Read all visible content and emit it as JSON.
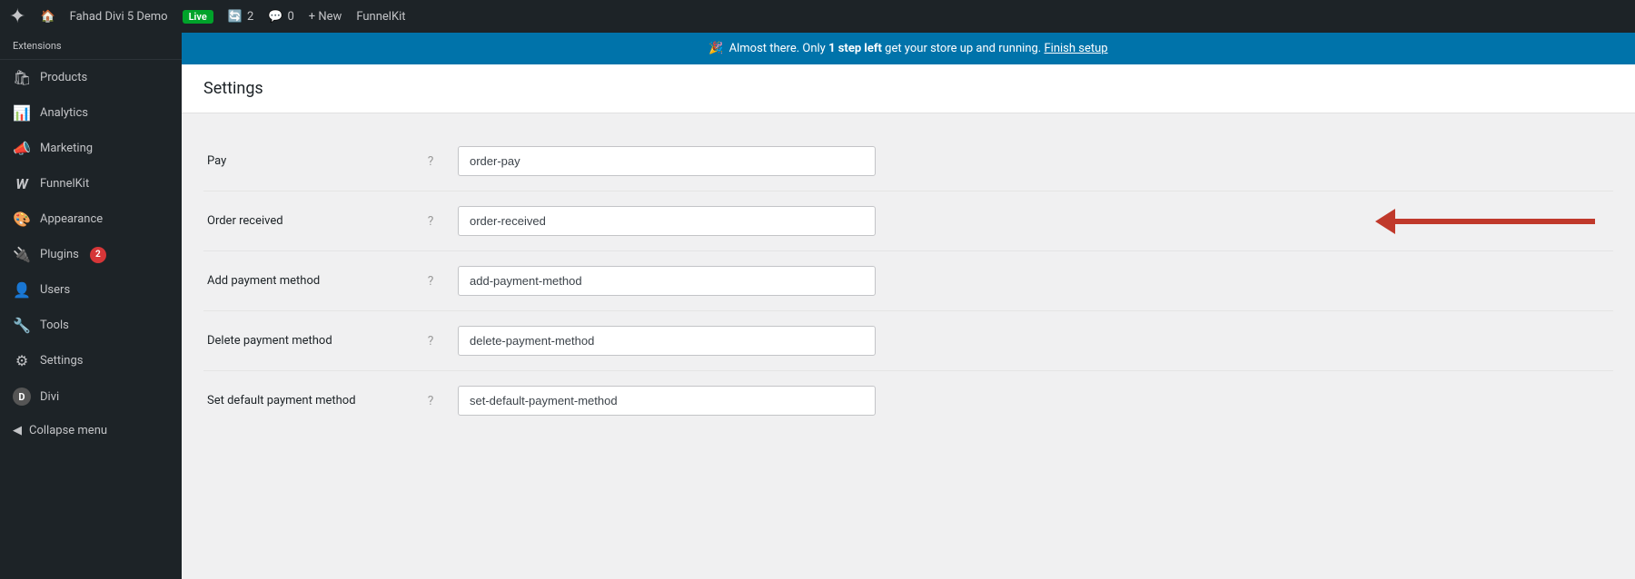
{
  "adminbar": {
    "wp_logo": "⊞",
    "site_name": "Fahad Divi 5 Demo",
    "live_badge": "Live",
    "sync_count": "2",
    "comments_icon": "💬",
    "comments_count": "0",
    "new_label": "+ New",
    "funnelkit_label": "FunnelKit"
  },
  "sidebar": {
    "extensions_label": "Extensions",
    "items": [
      {
        "id": "products",
        "icon": "🛍",
        "label": "Products"
      },
      {
        "id": "analytics",
        "icon": "📊",
        "label": "Analytics"
      },
      {
        "id": "marketing",
        "icon": "📣",
        "label": "Marketing"
      },
      {
        "id": "funnelkit",
        "icon": "W",
        "label": "FunnelKit"
      },
      {
        "id": "appearance",
        "icon": "🎨",
        "label": "Appearance"
      },
      {
        "id": "plugins",
        "icon": "🔌",
        "label": "Plugins",
        "badge": "2"
      },
      {
        "id": "users",
        "icon": "👤",
        "label": "Users"
      },
      {
        "id": "tools",
        "icon": "🔧",
        "label": "Tools"
      },
      {
        "id": "settings",
        "icon": "⚙",
        "label": "Settings"
      },
      {
        "id": "divi",
        "icon": "D",
        "label": "Divi"
      }
    ],
    "collapse_label": "Collapse menu"
  },
  "notice": {
    "emoji": "🎉",
    "text_before": "Almost there. Only ",
    "bold_text": "1 step left",
    "text_after": " get your store up and running.",
    "link_text": "Finish setup"
  },
  "page": {
    "title": "Settings",
    "form_rows": [
      {
        "id": "pay",
        "label": "Pay",
        "value": "order-pay",
        "has_arrow": false
      },
      {
        "id": "order-received",
        "label": "Order received",
        "value": "order-received",
        "has_arrow": true
      },
      {
        "id": "add-payment-method",
        "label": "Add payment method",
        "value": "add-payment-method",
        "has_arrow": false
      },
      {
        "id": "delete-payment-method",
        "label": "Delete payment method",
        "value": "delete-payment-method",
        "has_arrow": false
      },
      {
        "id": "set-default-payment-method",
        "label": "Set default payment method",
        "value": "set-default-payment-method",
        "has_arrow": false
      }
    ]
  }
}
